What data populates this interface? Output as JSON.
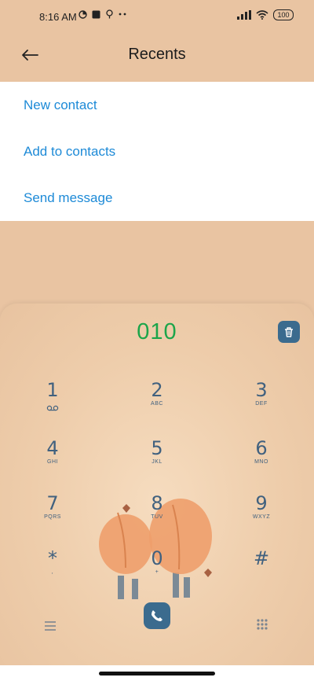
{
  "status_bar": {
    "time": "8:16 AM",
    "battery": "100"
  },
  "header": {
    "title": "Recents"
  },
  "actions": [
    {
      "label": "New contact"
    },
    {
      "label": "Add to contacts"
    },
    {
      "label": "Send message"
    }
  ],
  "dialer": {
    "number": "010",
    "keys": [
      {
        "digit": "1",
        "letters": ""
      },
      {
        "digit": "2",
        "letters": "ABC"
      },
      {
        "digit": "3",
        "letters": "DEF"
      },
      {
        "digit": "4",
        "letters": "GHI"
      },
      {
        "digit": "5",
        "letters": "JKL"
      },
      {
        "digit": "6",
        "letters": "MNO"
      },
      {
        "digit": "7",
        "letters": "PQRS"
      },
      {
        "digit": "8",
        "letters": "TUV"
      },
      {
        "digit": "9",
        "letters": "WXYZ"
      },
      {
        "digit": "*",
        "letters": ","
      },
      {
        "digit": "0",
        "letters": "+"
      },
      {
        "digit": "#",
        "letters": ""
      }
    ]
  },
  "colors": {
    "accent": "#1d8ad7",
    "number": "#1ca54a",
    "key": "#41617f",
    "button": "#3b6b8e",
    "background": "#e9c4a2"
  },
  "icons": {
    "back": "back-arrow-icon",
    "delete": "trash-icon",
    "call": "phone-icon",
    "menu": "menu-icon",
    "dialpad": "dialpad-icon",
    "voicemail": "voicemail-icon"
  }
}
